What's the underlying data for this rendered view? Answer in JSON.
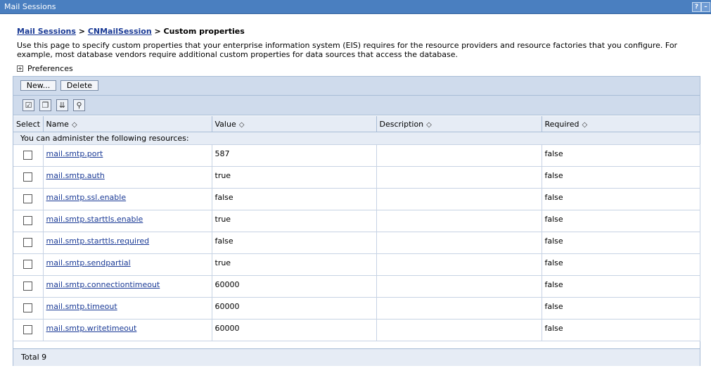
{
  "window": {
    "title": "Mail Sessions",
    "help_label": "?",
    "minimize_label": "–"
  },
  "breadcrumb": {
    "link1": "Mail Sessions",
    "sep1": " > ",
    "link2": "CNMailSession",
    "sep2": " > ",
    "current": "Custom properties"
  },
  "description": "Use this page to specify custom properties that your enterprise information system (EIS) requires for the resource providers and resource factories that you configure. For example, most database vendors require additional custom properties for data sources that access the database.",
  "preferences": {
    "expand_glyph": "+",
    "label": "Preferences"
  },
  "toolbar": {
    "new_label": "New...",
    "delete_label": "Delete"
  },
  "icon_toolbar": [
    {
      "name": "select-all-icon",
      "glyph": "☑"
    },
    {
      "name": "deselect-all-icon",
      "glyph": "❐"
    },
    {
      "name": "show-filter-icon",
      "glyph": "⇊"
    },
    {
      "name": "clear-filter-icon",
      "glyph": "⚲"
    }
  ],
  "table": {
    "columns": {
      "select": "Select",
      "name": "Name",
      "value": "Value",
      "description": "Description",
      "required": "Required"
    },
    "sort_glyph": "◇",
    "info_text": "You can administer the following resources:",
    "rows": [
      {
        "name": "mail.smtp.port",
        "value": "587",
        "description": "",
        "required": "false"
      },
      {
        "name": "mail.smtp.auth",
        "value": "true",
        "description": "",
        "required": "false"
      },
      {
        "name": "mail.smtp.ssl.enable",
        "value": "false",
        "description": "",
        "required": "false"
      },
      {
        "name": "mail.smtp.starttls.enable",
        "value": "true",
        "description": "",
        "required": "false"
      },
      {
        "name": "mail.smtp.starttls.required",
        "value": "false",
        "description": "",
        "required": "false"
      },
      {
        "name": "mail.smtp.sendpartial",
        "value": "true",
        "description": "",
        "required": "false"
      },
      {
        "name": "mail.smtp.connectiontimeout",
        "value": "60000",
        "description": "",
        "required": "false"
      },
      {
        "name": "mail.smtp.timeout",
        "value": "60000",
        "description": "",
        "required": "false"
      },
      {
        "name": "mail.smtp.writetimeout",
        "value": "60000",
        "description": "",
        "required": "false"
      }
    ],
    "total": "Total 9"
  },
  "colors": {
    "titlebar": "#4a7fc0",
    "panel_header": "#cfdbec",
    "column_header": "#e6ecf5",
    "link": "#1a3a96"
  }
}
